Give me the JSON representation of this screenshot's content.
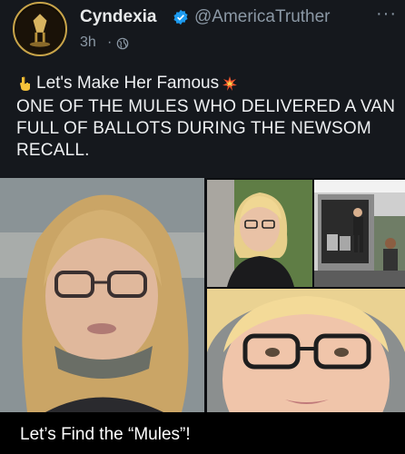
{
  "tweet": {
    "display_name": "Cyndexia",
    "handle": "@AmericaTruther",
    "time": "3h",
    "separator": "·",
    "more": "···",
    "line1": "Let's Make Her Famous",
    "body": "ONE OF THE MULES WHO DELIVERED A VAN FULL OF BALLOTS DURING THE NEWSOM RECALL.",
    "icons": [
      "pointing-down-emoji",
      "collision-emoji",
      "verified-badge",
      "globe-icon",
      "more-icon"
    ]
  },
  "media": {
    "caption": "Let’s Find the “Mules”!",
    "photos": [
      "photo-woman-closeup",
      "photo-woman-portrait",
      "photo-van-loading",
      "photo-woman-face-zoom"
    ]
  },
  "colors": {
    "background": "#15181d",
    "text": "#e7e9ea",
    "muted": "#8b98a5",
    "verified": "#1d9bf0",
    "caption_bar": "#000000"
  }
}
